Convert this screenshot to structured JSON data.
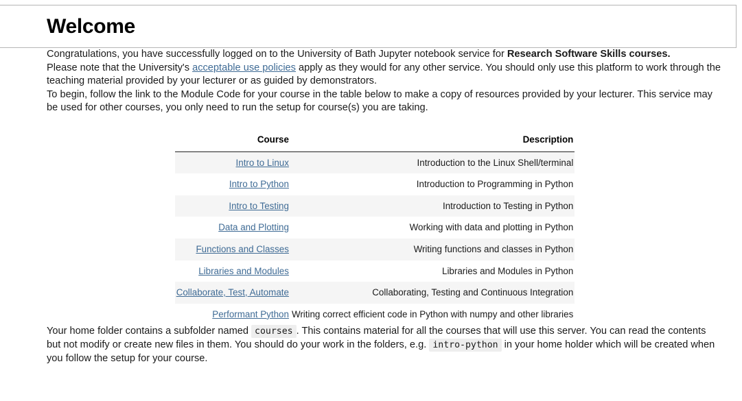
{
  "header": {
    "title": "Welcome"
  },
  "intro": {
    "p1_before": "Congratulations, you have successfully logged on to the University of Bath Jupyter notebook service for ",
    "p1_bold": "Research Software Skills courses.",
    "p2_before": "Please note that the University's ",
    "p2_link": "acceptable use policies",
    "p2_after": " apply as they would for any other service. You should only use this platform to work through the teaching material provided by your lecturer or as guided by demonstrators.",
    "p3": "To begin, follow the link to the Module Code for your course in the table below to make a copy of resources provided by your lecturer. This service may be used for other courses, you only need to run the setup for course(s) you are taking."
  },
  "courses_table": {
    "columns": [
      "Course",
      "Description"
    ],
    "rows": [
      {
        "course": "Intro to Linux",
        "description": "Introduction to the Linux Shell/terminal"
      },
      {
        "course": "Intro to Python",
        "description": "Introduction to Programming in Python"
      },
      {
        "course": "Intro to Testing",
        "description": "Introduction to Testing in Python"
      },
      {
        "course": "Data and Plotting",
        "description": "Working with data and plotting in Python"
      },
      {
        "course": "Functions and Classes",
        "description": "Writing functions and classes in Python"
      },
      {
        "course": "Libraries and Modules",
        "description": "Libraries and Modules in Python"
      },
      {
        "course": "Collaborate, Test, Automate",
        "description": "Collaborating, Testing and Continuous Integration"
      },
      {
        "course": "Performant Python",
        "description": "Writing correct efficient code in Python with numpy and other libraries"
      }
    ]
  },
  "footer_note": {
    "seg1": "Your home folder contains a subfolder named ",
    "code1": "courses",
    "seg2": ". This contains material for all the courses that will use this server. You can read the contents but not modify or create new files in them. You should do your work in the folders, e.g. ",
    "code2": "intro-python",
    "seg3": " in your home holder which will be created when you follow the setup for your course."
  },
  "colors": {
    "link": "#3f6b95",
    "row_stripe": "#f5f5f5",
    "border": "#b5b5b5",
    "header_rule": "#222222",
    "code_background": "#eeeeee"
  }
}
